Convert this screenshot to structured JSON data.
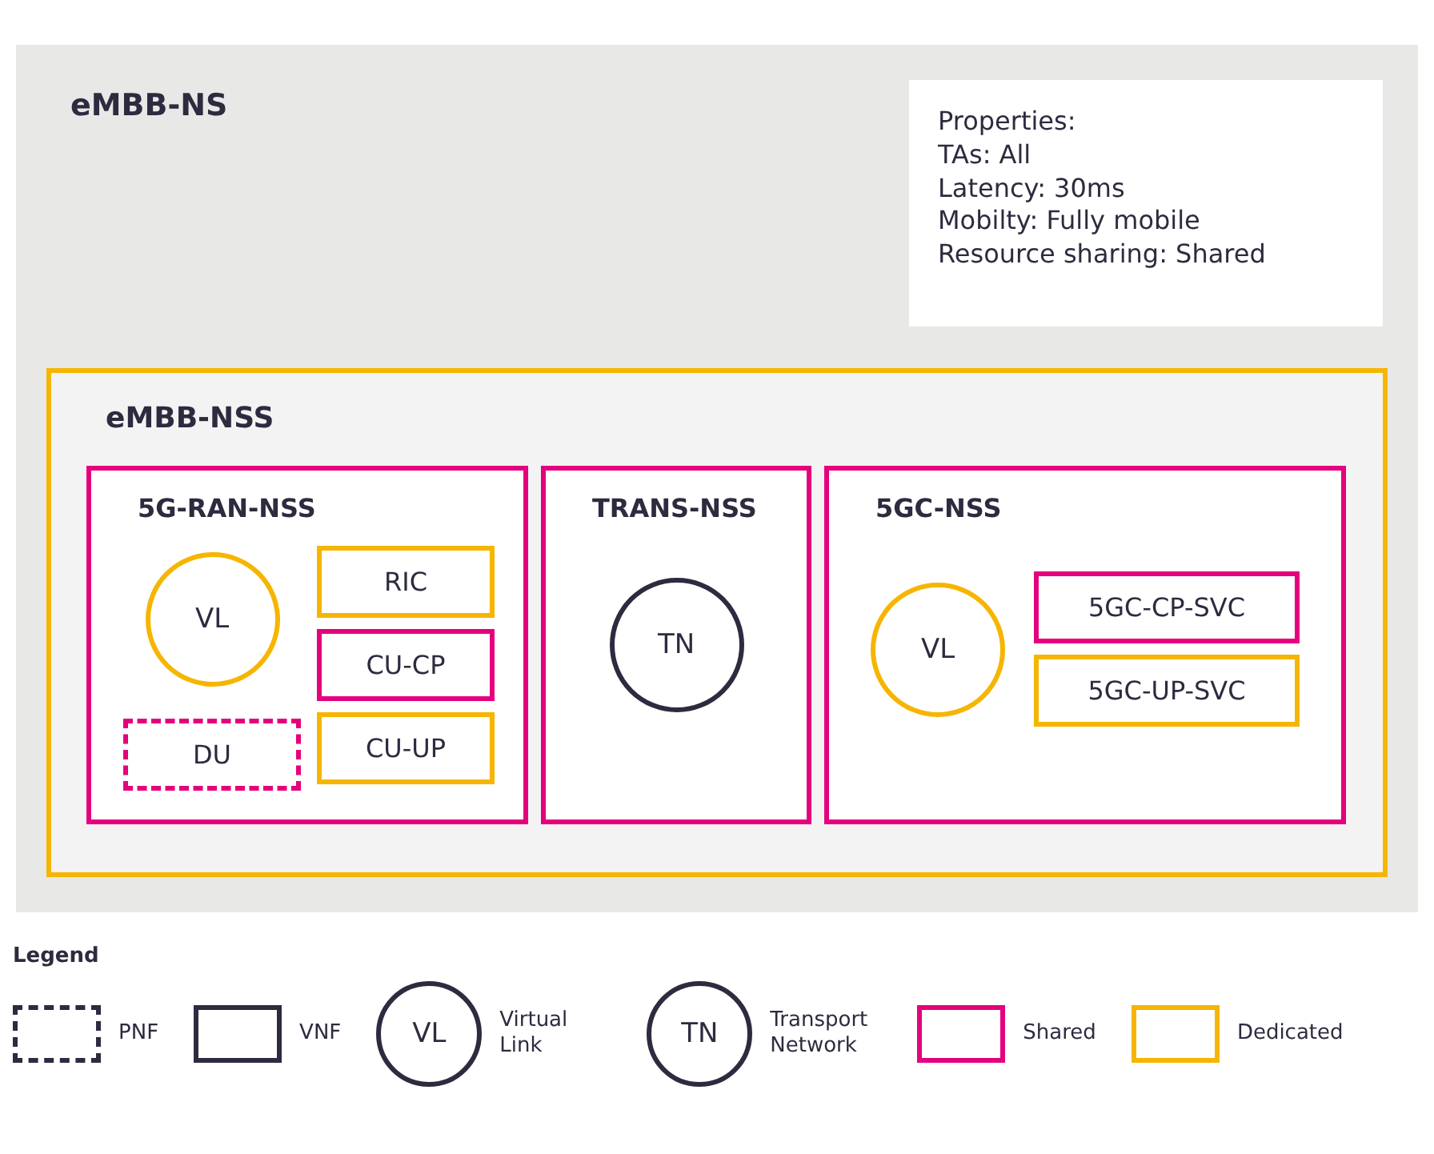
{
  "network_slice": {
    "title": "eMBB-NS",
    "properties": [
      "Properties:",
      "TAs: All",
      "Latency: 30ms",
      "Mobilty: Fully mobile",
      "Resource sharing: Shared"
    ],
    "subnet_slice": {
      "title": "eMBB-NSS",
      "color": "#f6b500",
      "subnets": [
        {
          "title": "5G-RAN-NSS",
          "color": "#e5007d",
          "items": [
            {
              "kind": "link",
              "label": "VL",
              "color": "#f6b500"
            },
            {
              "kind": "pnf",
              "label": "DU",
              "color": "#e5007d"
            },
            {
              "kind": "vnf",
              "label": "RIC",
              "color": "#f6b500"
            },
            {
              "kind": "vnf",
              "label": "CU-CP",
              "color": "#e5007d"
            },
            {
              "kind": "vnf",
              "label": "CU-UP",
              "color": "#f6b500"
            }
          ]
        },
        {
          "title": "TRANS-NSS",
          "color": "#e5007d",
          "items": [
            {
              "kind": "link",
              "label": "TN",
              "color": "#2d2b3f"
            }
          ]
        },
        {
          "title": "5GC-NSS",
          "color": "#e5007d",
          "items": [
            {
              "kind": "link",
              "label": "VL",
              "color": "#f6b500"
            },
            {
              "kind": "vnf",
              "label": "5GC-CP-SVC",
              "color": "#e5007d"
            },
            {
              "kind": "vnf",
              "label": "5GC-UP-SVC",
              "color": "#f6b500"
            }
          ]
        }
      ]
    }
  },
  "legend": {
    "title": "Legend",
    "items": [
      {
        "kind": "pnf",
        "label": "PNF",
        "color": "#2d2b3f"
      },
      {
        "kind": "vnf",
        "label": "VNF",
        "color": "#2d2b3f"
      },
      {
        "kind": "link",
        "symbol": "VL",
        "label": "Virtual Link",
        "color": "#2d2b3f"
      },
      {
        "kind": "link",
        "symbol": "TN",
        "label": "Transport Network",
        "color": "#2d2b3f"
      },
      {
        "kind": "vnf",
        "label": "Shared",
        "color": "#e5007d"
      },
      {
        "kind": "vnf",
        "label": "Dedicated",
        "color": "#f6b500"
      }
    ]
  }
}
